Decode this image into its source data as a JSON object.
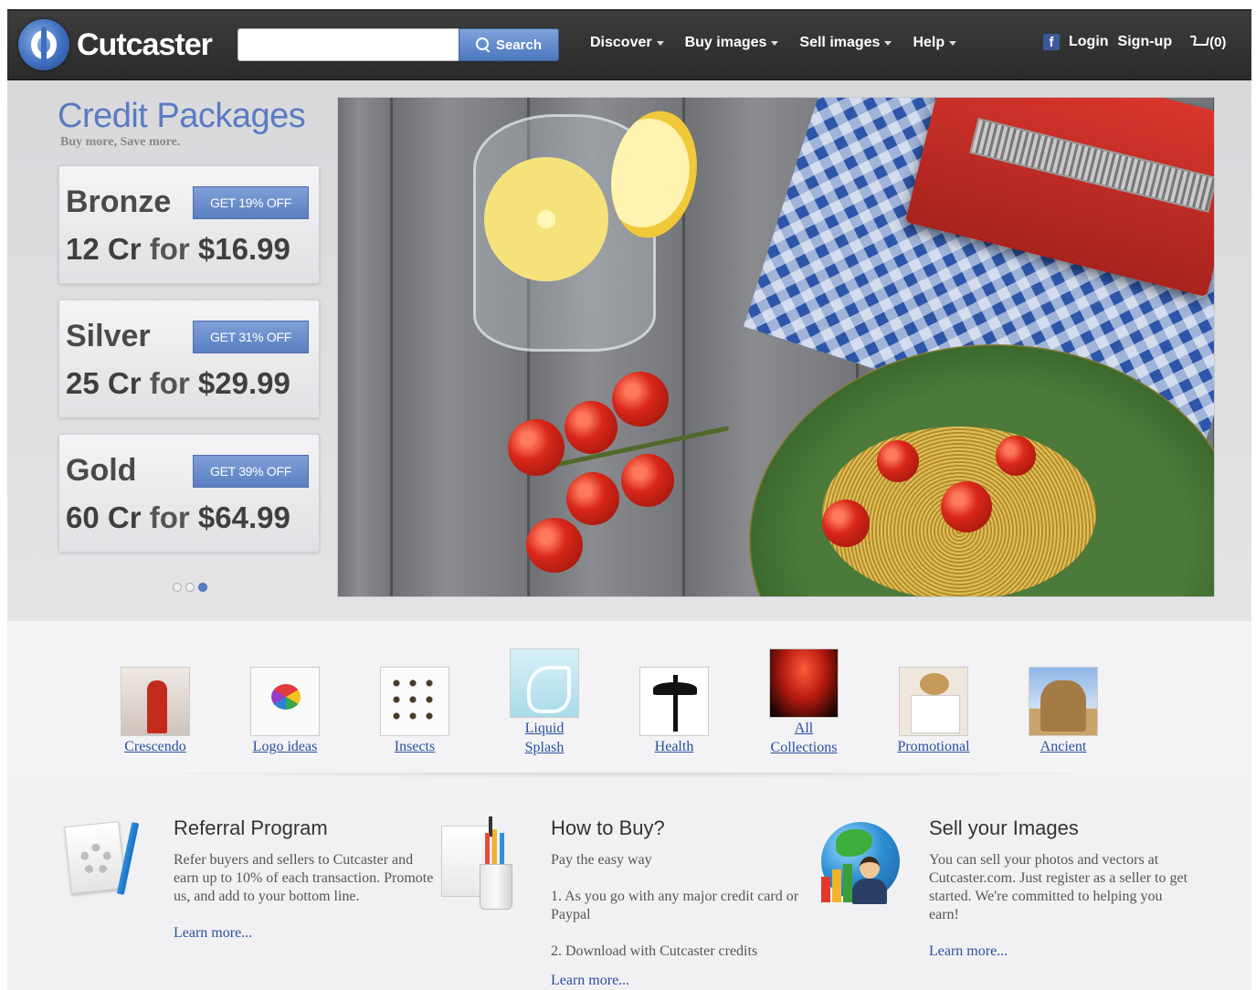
{
  "header": {
    "brand": "Cutcaster",
    "search": {
      "placeholder": "",
      "button_label": "Search"
    },
    "nav": [
      "Discover",
      "Buy images",
      "Sell images",
      "Help"
    ],
    "login_label": "Login",
    "signup_label": "Sign-up",
    "cart_label": "(0)"
  },
  "credit_packages": {
    "title": "Credit Packages",
    "subtitle": "Buy more, Save more.",
    "packages": [
      {
        "name": "Bronze",
        "badge": "GET 19% OFF",
        "credits": "12 Cr",
        "for_word": "for",
        "price": "$16.99"
      },
      {
        "name": "Silver",
        "badge": "GET 31% OFF",
        "credits": "25 Cr",
        "for_word": "for",
        "price": "$29.99"
      },
      {
        "name": "Gold",
        "badge": "GET 39% OFF",
        "credits": "60 Cr",
        "for_word": "for",
        "price": "$64.99"
      }
    ],
    "carousel": {
      "slides": 3,
      "active_index": 2
    }
  },
  "categories": [
    {
      "label": "Crescendo"
    },
    {
      "label": "Logo ideas"
    },
    {
      "label": "Insects"
    },
    {
      "label": "Liquid\nSplash"
    },
    {
      "label": "Health"
    },
    {
      "label": "All\nCollections"
    },
    {
      "label": "Promotional"
    },
    {
      "label": "Ancient"
    }
  ],
  "info": {
    "referral": {
      "title": "Referral Program",
      "body": "Refer buyers and sellers to Cutcaster and earn up to 10% of each transaction. Promote us, and add to your bottom line.",
      "link": "Learn more..."
    },
    "how_to_buy": {
      "title": "How to Buy?",
      "line1": "Pay the easy way",
      "line2": "1. As you go with any major credit card or Paypal",
      "line3": "2. Download with Cutcaster credits",
      "link": "Learn more..."
    },
    "sell": {
      "title": "Sell your Images",
      "body": "You can sell your photos and vectors at Cutcaster.com. Just register as a seller to get started. We're committed to helping you earn!",
      "link": "Learn more..."
    }
  },
  "colors": {
    "topbar": "#2f2f2f",
    "accent": "#5a7bc4",
    "link": "#2a4fa0"
  }
}
